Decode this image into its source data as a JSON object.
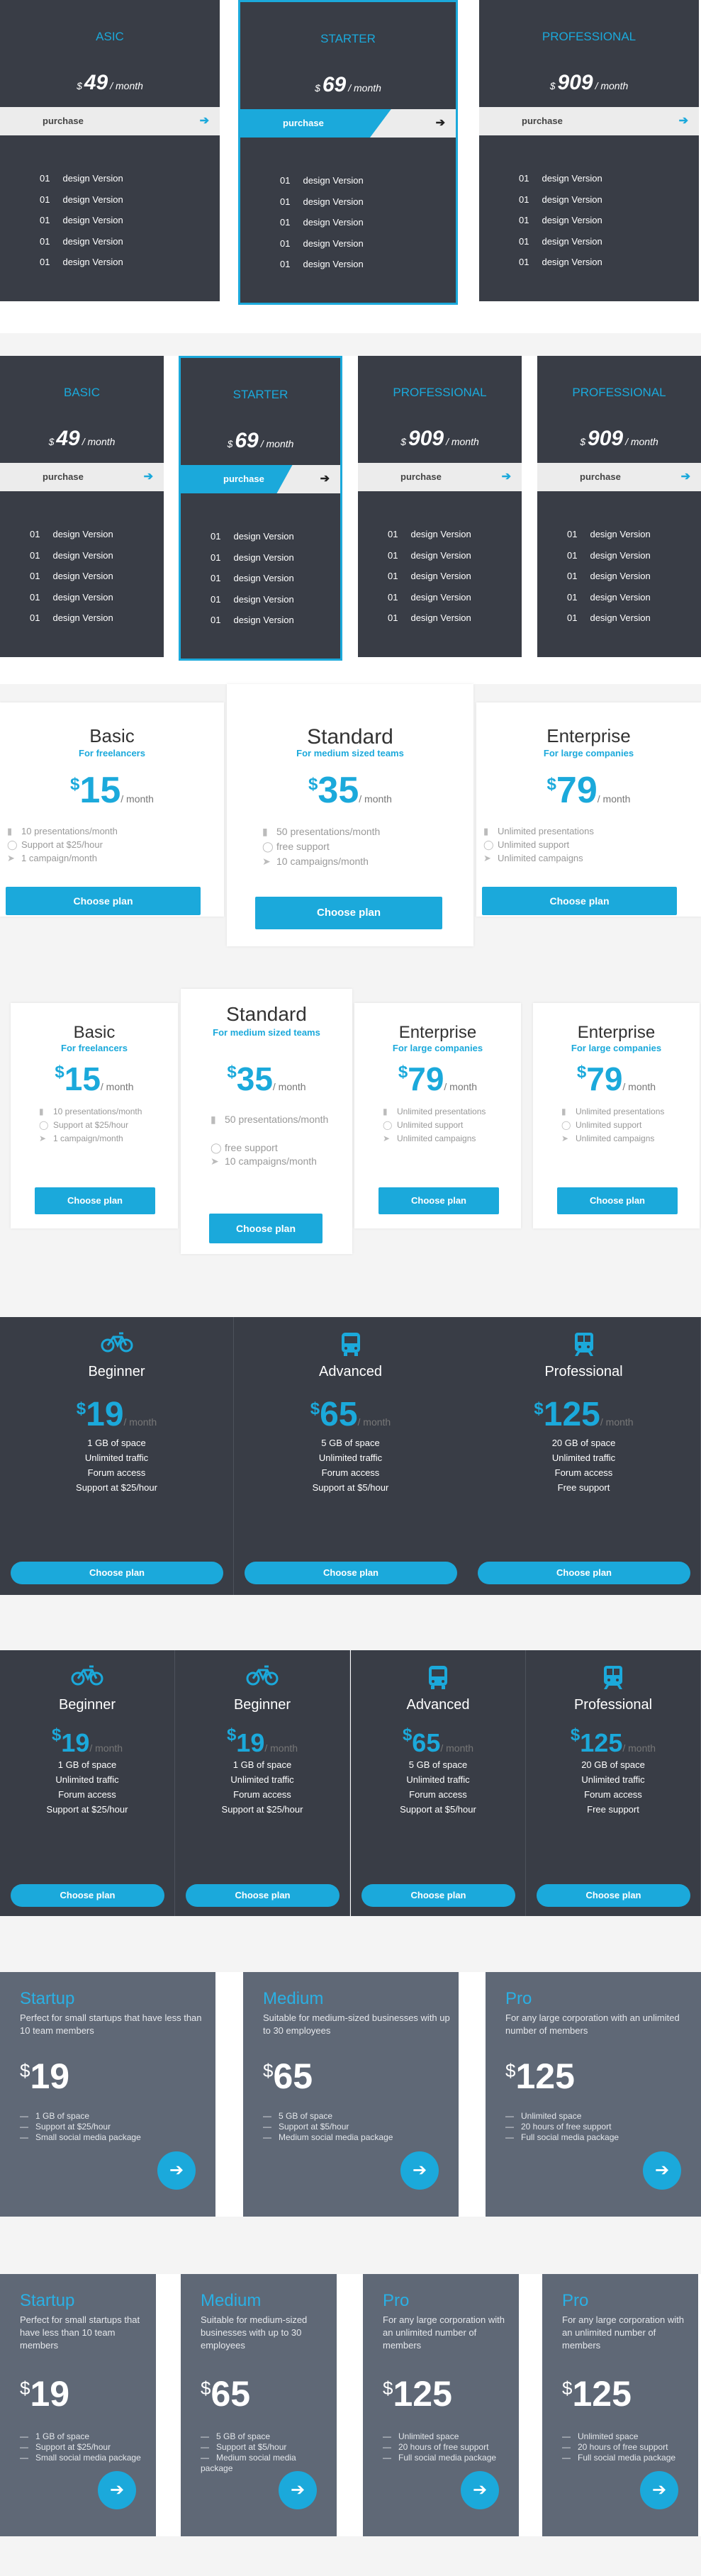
{
  "s1": {
    "cards": [
      {
        "name": "ASIC",
        "cur": "$",
        "price": "49",
        "per": "/ month",
        "btn": "purchase"
      },
      {
        "name": "STARTER",
        "cur": "$",
        "price": "69",
        "per": "/ month",
        "btn": "purchase"
      },
      {
        "name": "PROFESSIONAL",
        "cur": "$",
        "price": "909",
        "per": "/ month",
        "btn": "purchase"
      }
    ],
    "feat_num": "01",
    "feat": "design Version"
  },
  "s2": {
    "cards": [
      {
        "name": "BASIC",
        "cur": "$",
        "price": "49",
        "per": "/ month",
        "btn": "purchase"
      },
      {
        "name": "STARTER",
        "cur": "$",
        "price": "69",
        "per": "/ month",
        "btn": "purchase"
      },
      {
        "name": "PROFESSIONAL",
        "cur": "$",
        "price": "909",
        "per": "/ month",
        "btn": "purchase"
      },
      {
        "name": "PROFESSIONAL",
        "cur": "$",
        "price": "909",
        "per": "/ month",
        "btn": "purchase"
      }
    ]
  },
  "s3": {
    "cards": [
      {
        "t": "Basic",
        "st": "For freelancers",
        "cur": "$",
        "p": "15",
        "per": "/ month",
        "f": [
          "10 presentations/month",
          "Support at $25/hour",
          "1 campaign/month"
        ],
        "btn": "Choose plan"
      },
      {
        "t": "Standard",
        "st": "For medium sized teams",
        "cur": "$",
        "p": "35",
        "per": "/ month",
        "f": [
          "50 presentations/month",
          "free support",
          "10 campaigns/month"
        ],
        "btn": "Choose plan"
      },
      {
        "t": "Enterprise",
        "st": "For large companies",
        "cur": "$",
        "p": "79",
        "per": "/ month",
        "f": [
          "Unlimited presentations",
          "Unlimited support",
          "Unlimited campaigns"
        ],
        "btn": "Choose plan"
      }
    ]
  },
  "s4": {
    "cards": [
      {
        "t": "Basic",
        "st": "For freelancers",
        "cur": "$",
        "p": "15",
        "per": "/ month",
        "f": [
          "10 presentations/month",
          "Support at $25/hour",
          "1 campaign/month"
        ],
        "btn": "Choose plan"
      },
      {
        "t": "Standard",
        "st": "For medium sized teams",
        "cur": "$",
        "p": "35",
        "per": "/ month",
        "f": [
          "50 presentations/month",
          "free support",
          "10 campaigns/month"
        ],
        "btn": "Choose plan"
      },
      {
        "t": "Enterprise",
        "st": "For large companies",
        "cur": "$",
        "p": "79",
        "per": "/ month",
        "f": [
          "Unlimited presentations",
          "Unlimited support",
          "Unlimited campaigns"
        ],
        "btn": "Choose plan"
      },
      {
        "t": "Enterprise",
        "st": "For large companies",
        "cur": "$",
        "p": "79",
        "per": "/ month",
        "f": [
          "Unlimited presentations",
          "Unlimited support",
          "Unlimited campaigns"
        ],
        "btn": "Choose plan"
      }
    ]
  },
  "s5": {
    "cards": [
      {
        "icon": "bicycle-icon",
        "t": "Beginner",
        "cur": "$",
        "p": "19",
        "per": "/ month",
        "f": [
          "1 GB of space",
          "Unlimited traffic",
          "Forum access",
          "Support at $25/hour"
        ],
        "btn": "Choose plan"
      },
      {
        "icon": "bus-icon",
        "t": "Advanced",
        "cur": "$",
        "p": "65",
        "per": "/ month",
        "f": [
          "5 GB of space",
          "Unlimited traffic",
          "Forum access",
          "Support at $5/hour"
        ],
        "btn": "Choose plan"
      },
      {
        "icon": "train-icon",
        "t": "Professional",
        "cur": "$",
        "p": "125",
        "per": "/ month",
        "f": [
          "20 GB of space",
          "Unlimited traffic",
          "Forum access",
          "Free support"
        ],
        "btn": "Choose plan"
      }
    ]
  },
  "s6": {
    "cards": [
      {
        "icon": "bicycle-icon",
        "t": "Beginner",
        "cur": "$",
        "p": "19",
        "per": "/ month",
        "f": [
          "1 GB of space",
          "Unlimited traffic",
          "Forum access",
          "Support at $25/hour"
        ],
        "btn": "Choose plan"
      },
      {
        "icon": "bicycle-icon",
        "t": "Beginner",
        "cur": "$",
        "p": "19",
        "per": "/ month",
        "f": [
          "1 GB of space",
          "Unlimited traffic",
          "Forum access",
          "Support at $25/hour"
        ],
        "btn": "Choose plan"
      },
      {
        "icon": "bus-icon",
        "t": "Advanced",
        "cur": "$",
        "p": "65",
        "per": "/ month",
        "f": [
          "5 GB of space",
          "Unlimited traffic",
          "Forum access",
          "Support at $5/hour"
        ],
        "btn": "Choose plan"
      },
      {
        "icon": "train-icon",
        "t": "Professional",
        "cur": "$",
        "p": "125",
        "per": "/ month",
        "f": [
          "20 GB of space",
          "Unlimited traffic",
          "Forum access",
          "Free support"
        ],
        "btn": "Choose plan"
      }
    ]
  },
  "s7": {
    "cards": [
      {
        "t": "Startup",
        "d": "Perfect for small startups that have less than 10 team members",
        "cur": "$",
        "p": "19",
        "f": [
          "1 GB of space",
          "Support at $25/hour",
          "Small social media package"
        ]
      },
      {
        "t": "Medium",
        "d": "Suitable for medium-sized businesses with up to 30 employees",
        "cur": "$",
        "p": "65",
        "f": [
          "5 GB of space",
          "Support at $5/hour",
          "Medium social media package"
        ]
      },
      {
        "t": "Pro",
        "d": "For any large corporation with an unlimited number of members",
        "cur": "$",
        "p": "125",
        "f": [
          "Unlimited space",
          "20 hours of free support",
          "Full social media package"
        ]
      }
    ]
  },
  "s8": {
    "cards": [
      {
        "t": "Startup",
        "d": "Perfect for small startups that have less than 10 team members",
        "cur": "$",
        "p": "19",
        "f": [
          "1 GB of space",
          "Support at $25/hour",
          "Small social media package"
        ]
      },
      {
        "t": "Medium",
        "d": "Suitable for medium-sized businesses with up to 30 employees",
        "cur": "$",
        "p": "65",
        "f": [
          "5 GB of space",
          "Support at $5/hour",
          "Medium social media package"
        ]
      },
      {
        "t": "Pro",
        "d": "For any large corporation with an unlimited number of members",
        "cur": "$",
        "p": "125",
        "f": [
          "Unlimited space",
          "20 hours of free support",
          "Full social media package"
        ]
      },
      {
        "t": "Pro",
        "d": "For any large corporation with an unlimited number of members",
        "cur": "$",
        "p": "125",
        "f": [
          "Unlimited space",
          "20 hours of free support",
          "Full social media package"
        ]
      }
    ]
  },
  "colors": {
    "accent": "#1ba9db",
    "dark": "#393d46",
    "slate": "#5f6876"
  }
}
